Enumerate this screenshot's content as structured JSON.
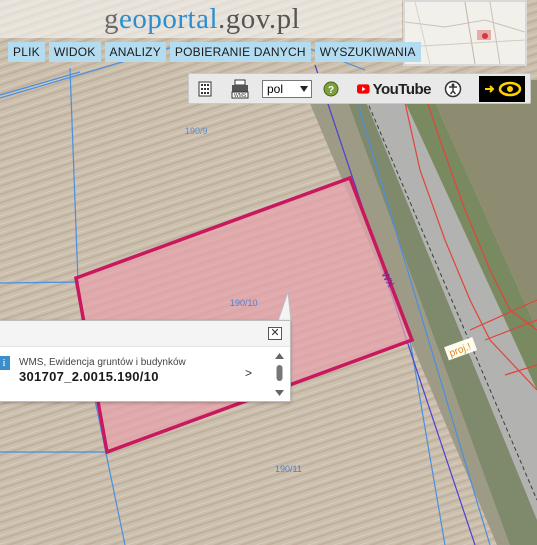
{
  "logo": {
    "part1": "g",
    "part2": "eoportal",
    "part3": ".gov.pl"
  },
  "menu": [
    "PLIK",
    "WIDOK",
    "ANALIZY",
    "POBIERANIE DANYCH",
    "WYSZUKIWANIA"
  ],
  "toolbar": {
    "language": "pol",
    "youtube_label": "YouTube"
  },
  "map_labels": {
    "parcel_1": "190/9",
    "parcel_2": "190/10",
    "parcel_3": "190/11",
    "road": "WX",
    "proj": "proj.!"
  },
  "popup": {
    "layer_name": "WMS, Ewidencja gruntów i budynków",
    "parcel_id": "301707_2.0015.190/10",
    "close": "✕",
    "more": ">"
  },
  "colors": {
    "parcel_outline": "#c8185e",
    "parcel_fill": "#e7a2ad",
    "cadastral_lines": "#4a8fe0",
    "menu_bg": "#b3dcf1",
    "accent": "#2a8fd0"
  }
}
